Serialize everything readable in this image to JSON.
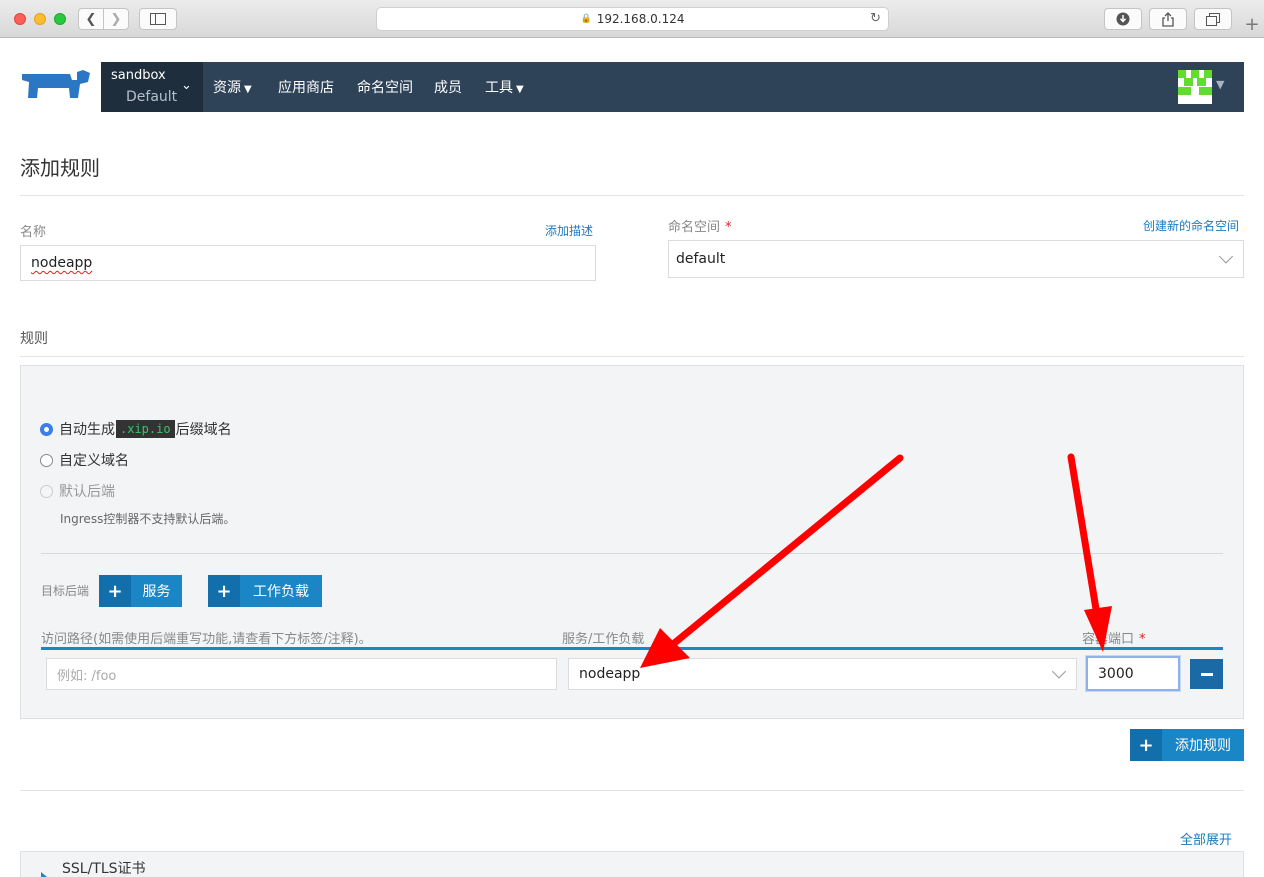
{
  "browser": {
    "address": "192.168.0.124"
  },
  "header": {
    "cluster_name": "sandbox",
    "project_name": "Default",
    "nav": [
      {
        "label": "资源",
        "has_dropdown": true
      },
      {
        "label": "应用商店",
        "has_dropdown": false
      },
      {
        "label": "命名空间",
        "has_dropdown": false
      },
      {
        "label": "成员",
        "has_dropdown": false
      },
      {
        "label": "工具",
        "has_dropdown": true
      }
    ]
  },
  "page": {
    "title": "添加规则",
    "name_label": "名称",
    "add_desc_link": "添加描述",
    "name_value": "nodeapp",
    "namespace_label": "命名空间",
    "namespace_required": "*",
    "create_namespace_link": "创建新的命名空间",
    "namespace_value": "default",
    "rules_heading": "规则"
  },
  "rules": {
    "hostname_options": [
      {
        "label_before": "自动生成",
        "code": ".xip.io",
        "label_after": "后缀域名",
        "selected": true,
        "disabled": false
      },
      {
        "label": "自定义域名",
        "selected": false,
        "disabled": false
      },
      {
        "label": "默认后端",
        "selected": false,
        "disabled": true
      }
    ],
    "default_backend_hint": "Ingress控制器不支持默认后端。",
    "target_backend_label": "目标后端",
    "add_service_button": "服务",
    "add_workload_button": "工作负载",
    "columns": {
      "path": "访问路径(如需使用后端重写功能,请查看下方标签/注释)。",
      "target": "服务/工作负载",
      "port": "容器端口",
      "port_required": "*"
    },
    "row": {
      "path_placeholder": "例如: /foo",
      "target_value": "nodeapp",
      "port_value": "3000"
    },
    "add_rule_button": "添加规则"
  },
  "footer": {
    "expand_all_link": "全部展开",
    "ssl_section_title": "SSL/TLS证书"
  },
  "colors": {
    "accent": "#1b86c6",
    "nav_bg": "#2e4258",
    "annotation_arrow": "#ff0000"
  }
}
